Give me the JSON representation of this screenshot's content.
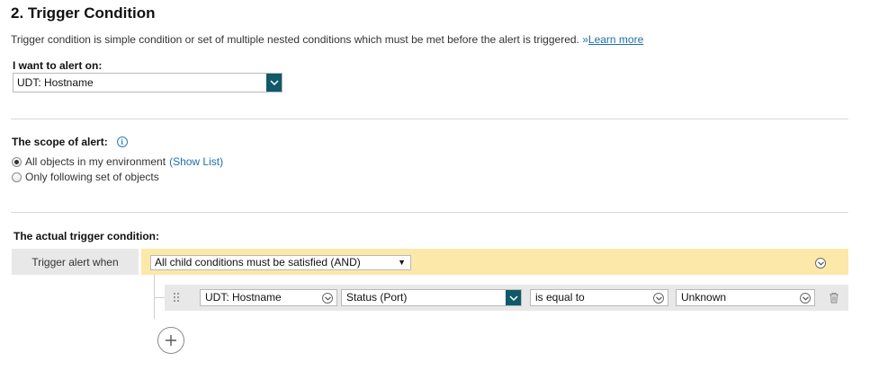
{
  "section": {
    "title": "2. Trigger Condition",
    "description": "Trigger condition is simple condition or set of multiple nested conditions which must be met before the alert is triggered.",
    "learn_more_prefix": "»",
    "learn_more": "Learn more"
  },
  "alert_on": {
    "label": "I want to alert on:",
    "value": "UDT: Hostname"
  },
  "scope": {
    "label": "The scope of alert:",
    "options": [
      {
        "label": "All objects in my environment",
        "checked": true,
        "extra": "(Show List)"
      },
      {
        "label": "Only following set of objects",
        "checked": false
      }
    ]
  },
  "trigger": {
    "label": "The actual trigger condition:",
    "when_label": "Trigger alert when",
    "group_select": "All child conditions must be satisfied (AND)",
    "condition": {
      "object": "UDT: Hostname",
      "field": "Status (Port)",
      "operator": "is equal to",
      "value": "Unknown"
    }
  },
  "icons": {
    "info": "info-icon",
    "drag": "drag-handle-icon",
    "delete": "trash-icon",
    "add": "plus-icon",
    "chevron": "chevron-down-icon"
  },
  "colors": {
    "accent": "#0f5969",
    "link": "#1e6fa8",
    "group_bar": "#fce8a8",
    "row_bar": "#e8e8e8"
  }
}
